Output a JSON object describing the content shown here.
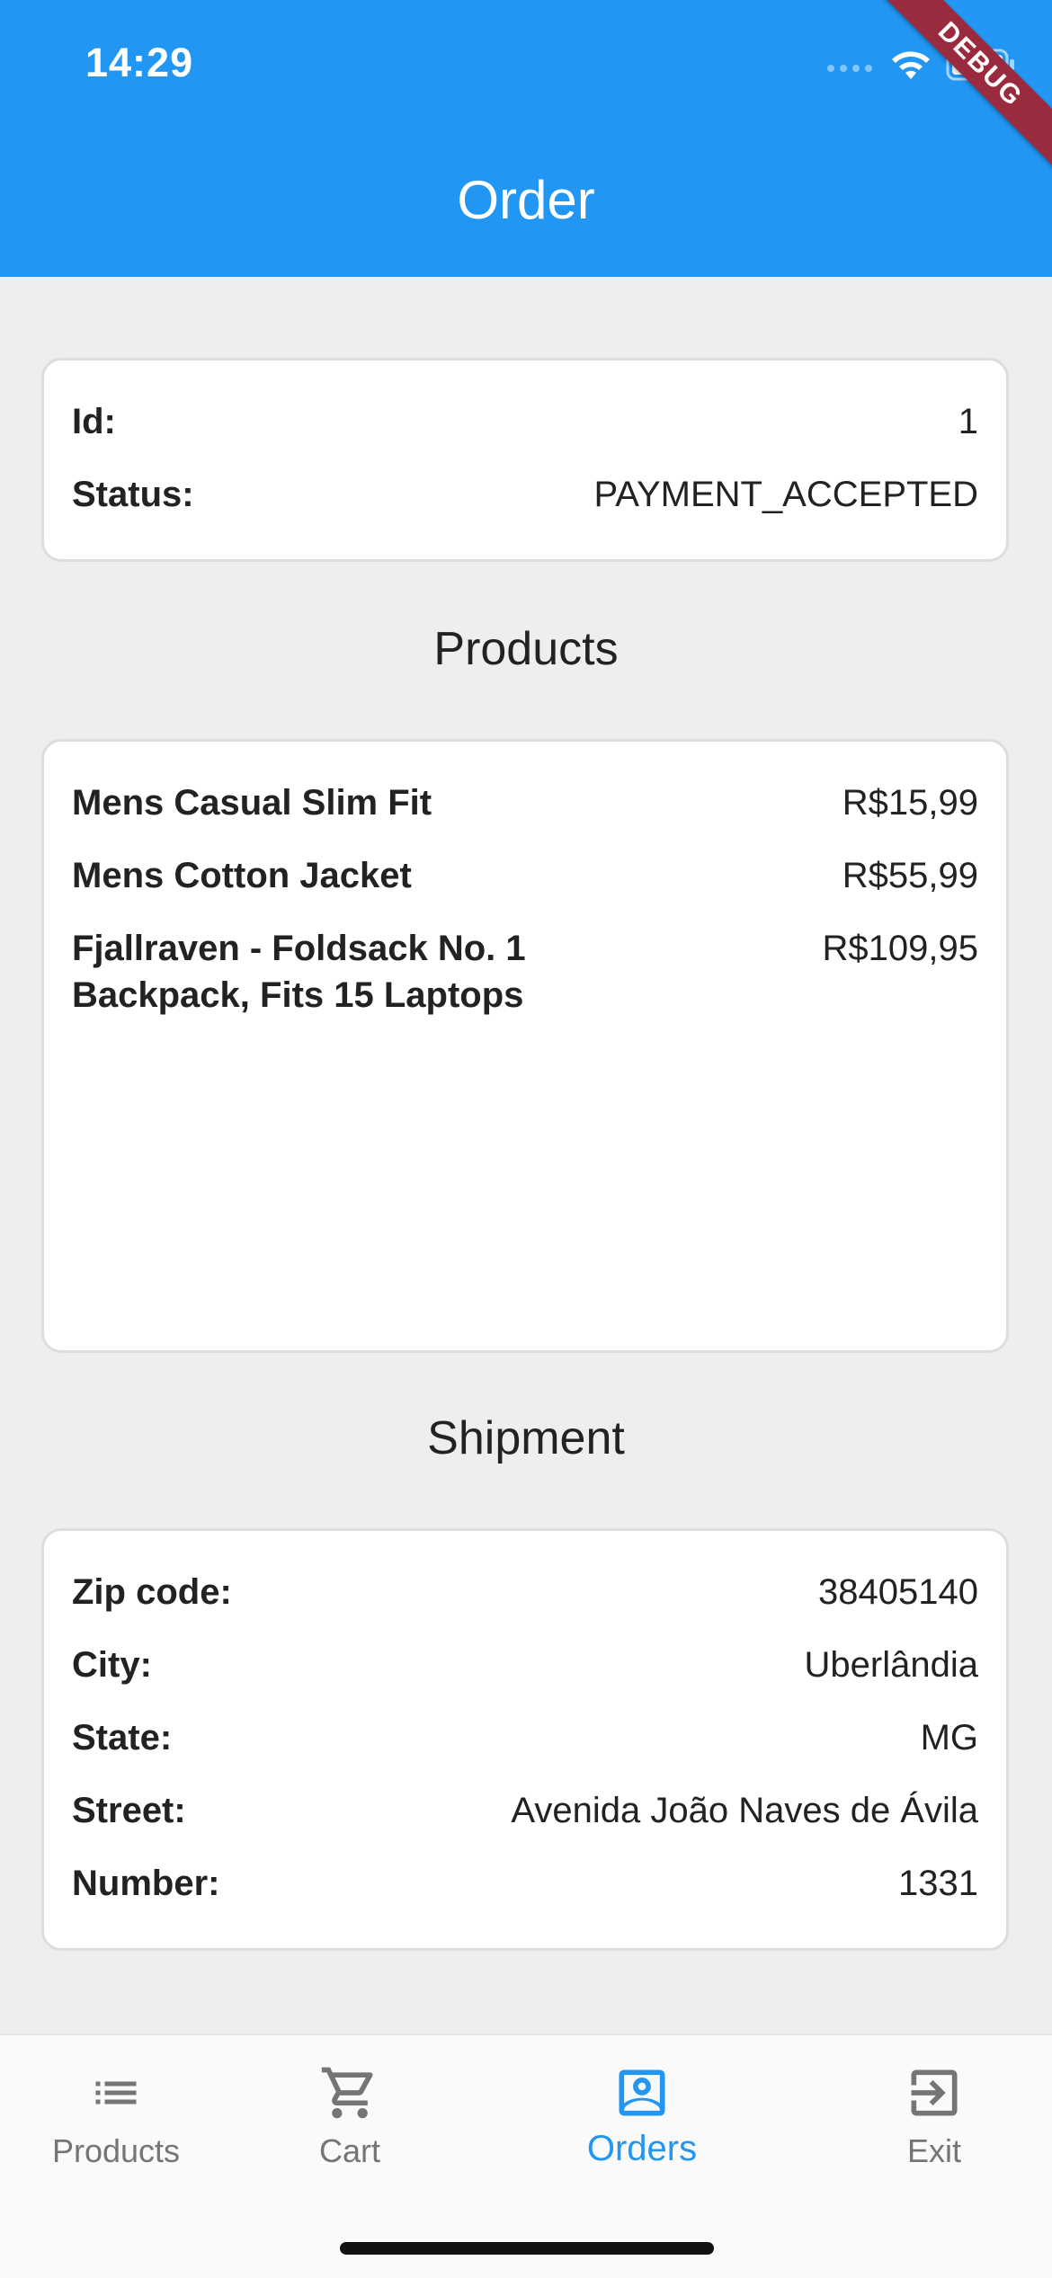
{
  "status_bar": {
    "time": "14:29",
    "debug_label": "DEBUG"
  },
  "appbar": {
    "title": "Order"
  },
  "order_card": {
    "id_label": "Id:",
    "id_value": "1",
    "status_label": "Status:",
    "status_value": "PAYMENT_ACCEPTED"
  },
  "products_section": {
    "title": "Products",
    "items": [
      {
        "name": "Mens Casual Slim Fit",
        "price": "R$15,99"
      },
      {
        "name": "Mens Cotton Jacket",
        "price": "R$55,99"
      },
      {
        "name": "Fjallraven - Foldsack No. 1 Backpack, Fits 15 Laptops",
        "price": "R$109,95"
      }
    ]
  },
  "shipment_section": {
    "title": "Shipment",
    "fields": [
      {
        "label": "Zip code:",
        "value": "38405140"
      },
      {
        "label": "City:",
        "value": "Uberlândia"
      },
      {
        "label": "State:",
        "value": "MG"
      },
      {
        "label": "Street:",
        "value": "Avenida João Naves de Ávila"
      },
      {
        "label": "Number:",
        "value": "1331"
      }
    ]
  },
  "bottom_nav": {
    "items": [
      {
        "label": "Products",
        "icon": "list-icon",
        "active": false
      },
      {
        "label": "Cart",
        "icon": "cart-icon",
        "active": false
      },
      {
        "label": "Orders",
        "icon": "account-box-icon",
        "active": true
      },
      {
        "label": "Exit",
        "icon": "exit-icon",
        "active": false
      }
    ]
  },
  "colors": {
    "primary": "#2196f3",
    "background": "#eeeeee",
    "card": "#ffffff",
    "debug_ribbon": "#9a2a3e",
    "nav_inactive": "#757575"
  }
}
